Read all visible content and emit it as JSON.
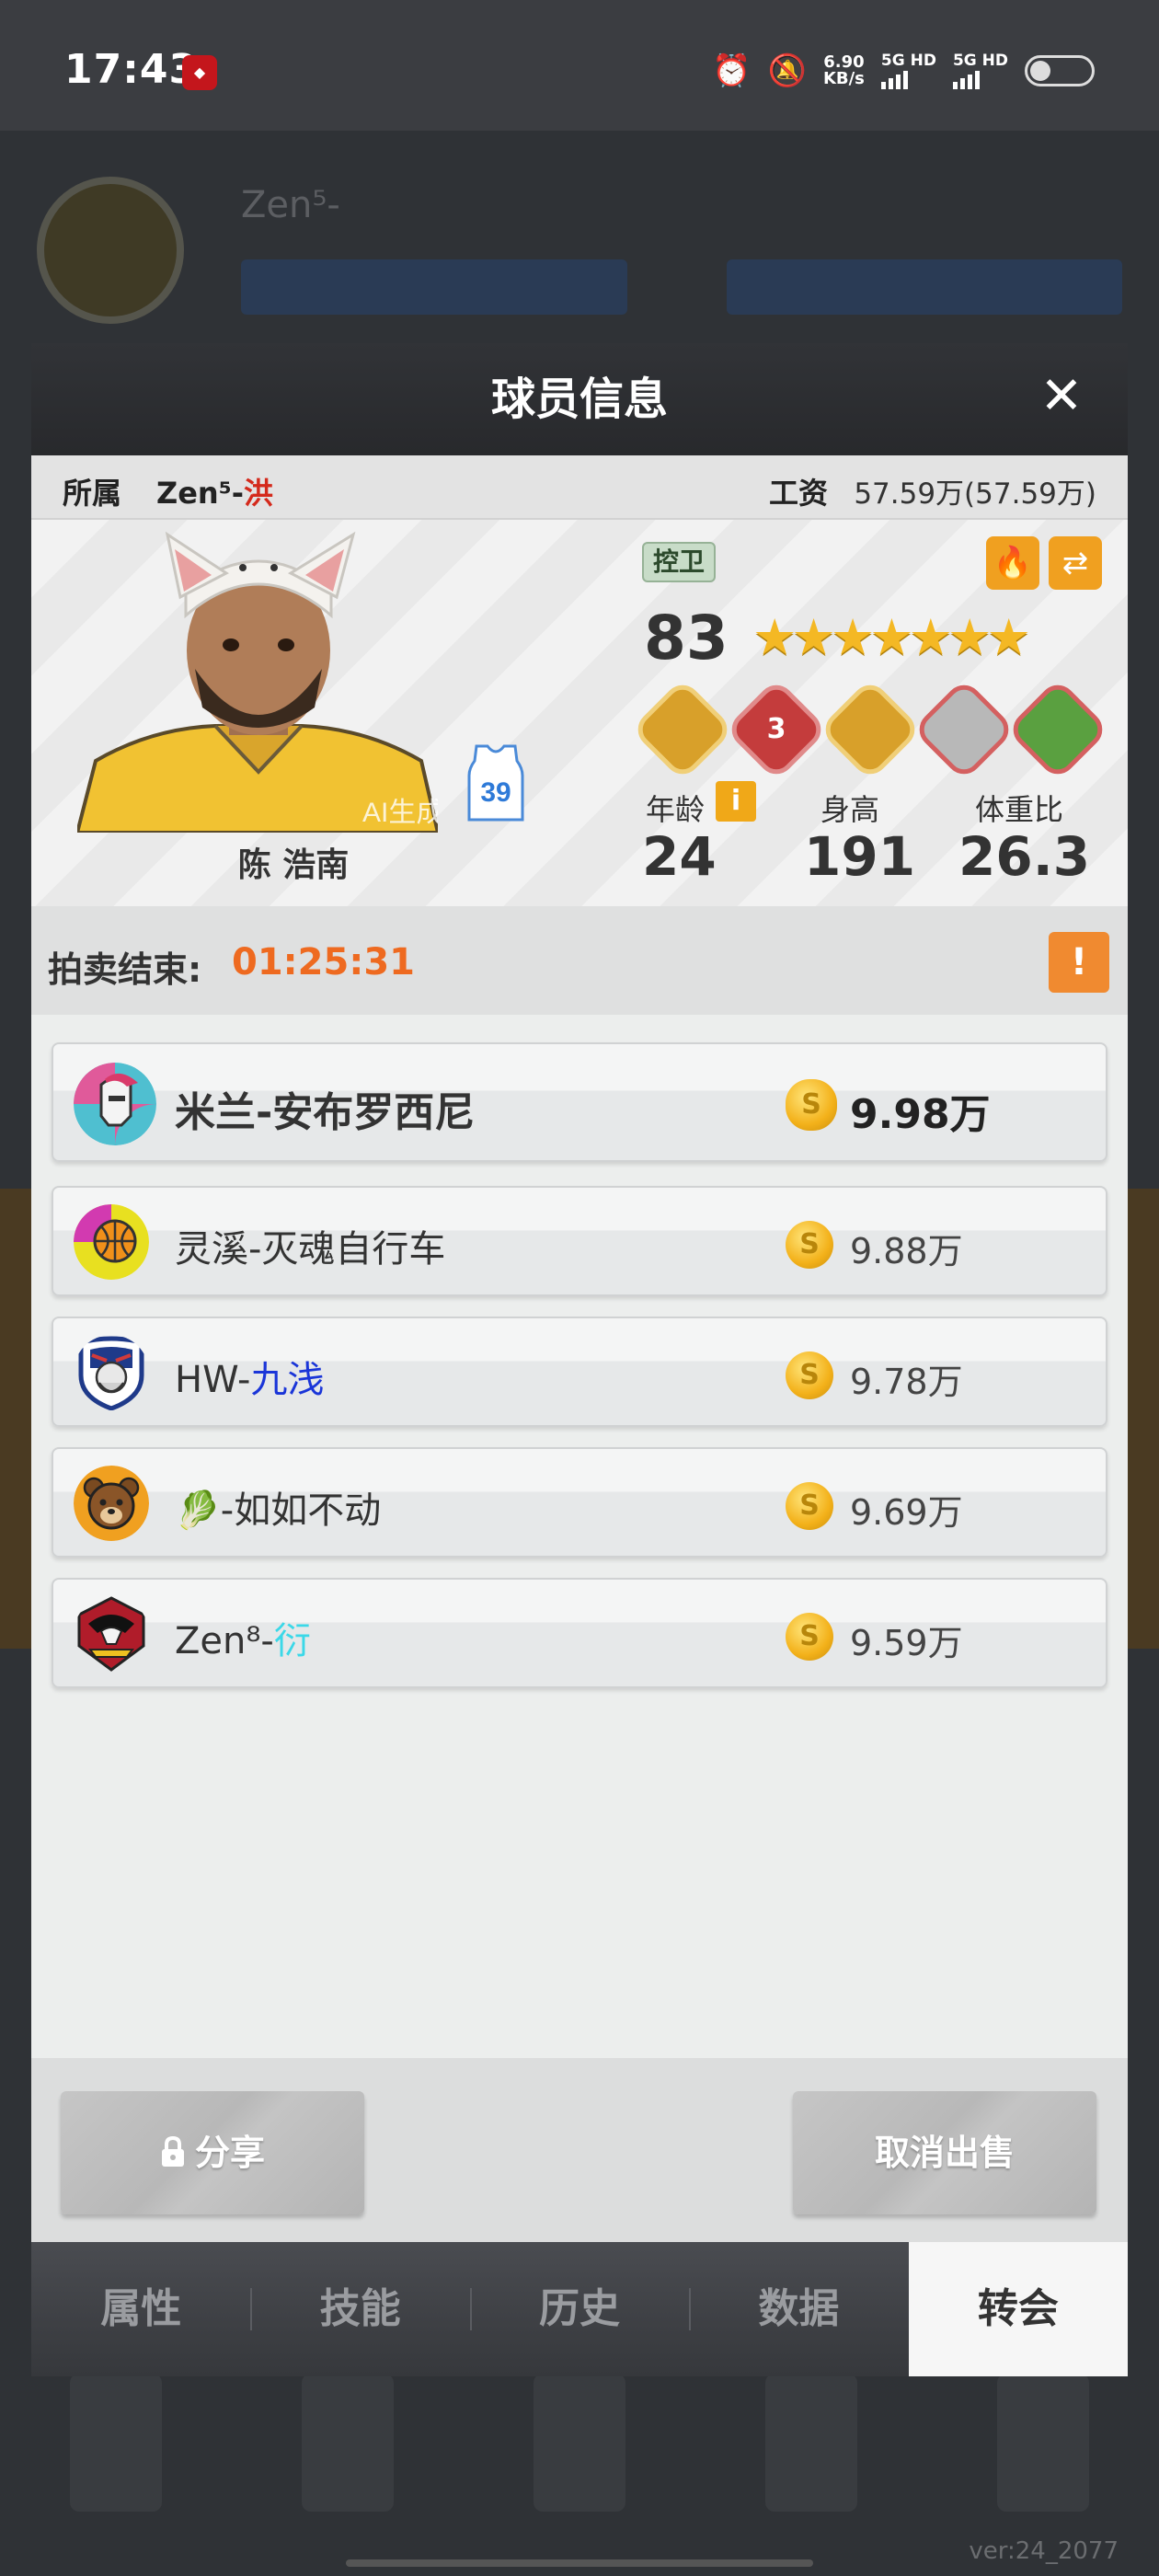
{
  "status_bar": {
    "time": "17:43",
    "app_icon": "app-notification-icon",
    "net_speed_value": "6.90",
    "net_speed_unit": "KB/s",
    "sim1": "5G HD",
    "sim2": "5G HD",
    "icons": [
      "alarm-icon",
      "mute-icon",
      "signal-icon",
      "battery-icon"
    ]
  },
  "dialog": {
    "title": "球员信息",
    "close_icon": "close-icon",
    "owner_label": "所属",
    "owner_name_prefix": "Zen⁵-",
    "owner_name_suffix": "洪",
    "salary_label": "工资",
    "salary_value": "57.59万(57.59万)"
  },
  "player": {
    "name": "陈 浩南",
    "ai_tag": "AI生成",
    "jersey_number": "39",
    "position": "控卫",
    "rating": "83",
    "stars": "★★★★★★★",
    "skill_badges": [
      {
        "name": "skill-badge-1",
        "label": ""
      },
      {
        "name": "skill-badge-2",
        "label": "3"
      },
      {
        "name": "skill-badge-3",
        "label": ""
      },
      {
        "name": "skill-badge-4",
        "label": ""
      },
      {
        "name": "skill-badge-5",
        "label": ""
      }
    ],
    "age_label": "年龄",
    "age_info": "i",
    "age": "24",
    "height_label": "身高",
    "height": "191",
    "weight_label": "体重比",
    "weight": "26.3"
  },
  "auction": {
    "label": "拍卖结束:",
    "time_left": "01:25:31",
    "warn_icon": "!"
  },
  "bids": [
    {
      "team_prefix": "米兰-安布罗西尼",
      "team_suffix": "",
      "coin": "S",
      "amount": "9.98万"
    },
    {
      "team_prefix": "灵溪-灭魂自行车",
      "team_suffix": "",
      "coin": "S",
      "amount": "9.88万"
    },
    {
      "team_prefix": "HW-",
      "team_suffix": "九浅",
      "coin": "S",
      "amount": "9.78万"
    },
    {
      "team_prefix": "🥬-如如不动",
      "team_suffix": "",
      "coin": "S",
      "amount": "9.69万"
    },
    {
      "team_prefix": "Zen⁸-",
      "team_suffix": "衍",
      "coin": "S",
      "amount": "9.59万"
    }
  ],
  "actions": {
    "share_label": "分享",
    "cancel_label": "取消出售"
  },
  "tabs": [
    "属性",
    "技能",
    "历史",
    "数据",
    "转会"
  ],
  "active_tab": "转会",
  "version": "ver:24_2077",
  "colors": {
    "accent_orange": "#ee6a20",
    "owner_red": "#d42a1c",
    "team_blue": "#1a35d8",
    "team_cyan": "#3bd8e8",
    "coin_gold": "#f3b11a"
  }
}
